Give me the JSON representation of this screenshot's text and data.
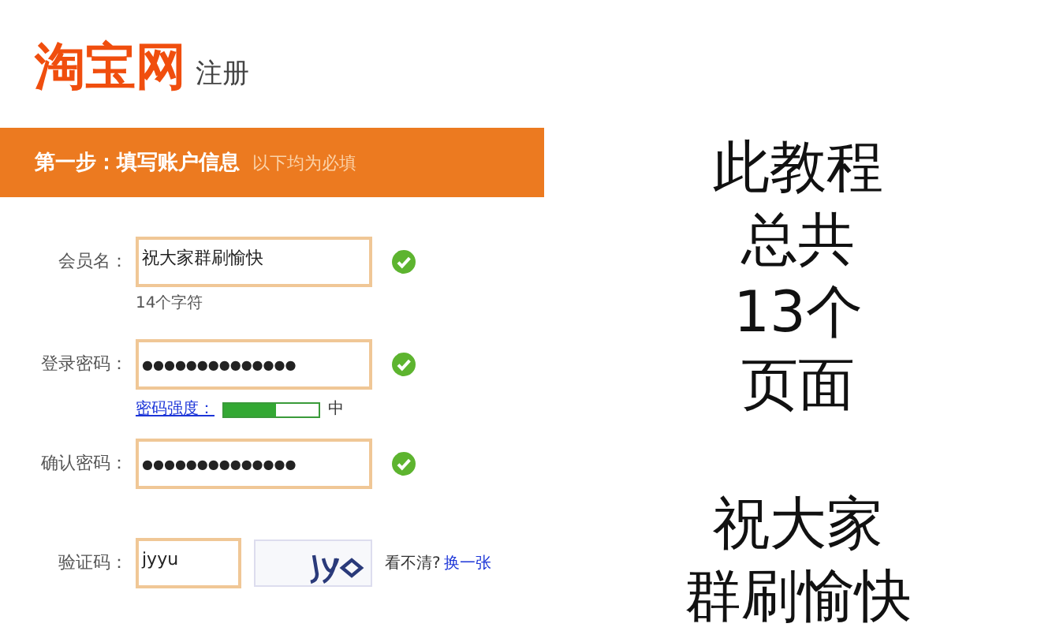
{
  "logo": {
    "brand": "淘宝网",
    "subtitle": "注册"
  },
  "step_bar": {
    "title": "第一步：填写账户信息",
    "note": "以下均为必填"
  },
  "fields": [
    {
      "kind": "text",
      "label": "会员名：",
      "value": "祝大家群刷愉快",
      "valid": true,
      "hint": "14个字符"
    },
    {
      "kind": "password",
      "label": "登录密码：",
      "value": "●●●●●●●●●●●●●●",
      "valid": true,
      "strength": {
        "label": "密码强度：",
        "level": 0.55,
        "reading": "中"
      }
    },
    {
      "kind": "password",
      "label": "确认密码：",
      "value": "●●●●●●●●●●●●●●",
      "valid": true
    },
    {
      "kind": "captcha",
      "label": "验证码：",
      "value": "jyyu",
      "hint": "看不清?",
      "link": "换一张"
    }
  ],
  "caption": [
    [
      "此教程",
      "总共",
      "13个",
      "页面"
    ],
    [
      "祝大家",
      "群刷愉快"
    ]
  ]
}
